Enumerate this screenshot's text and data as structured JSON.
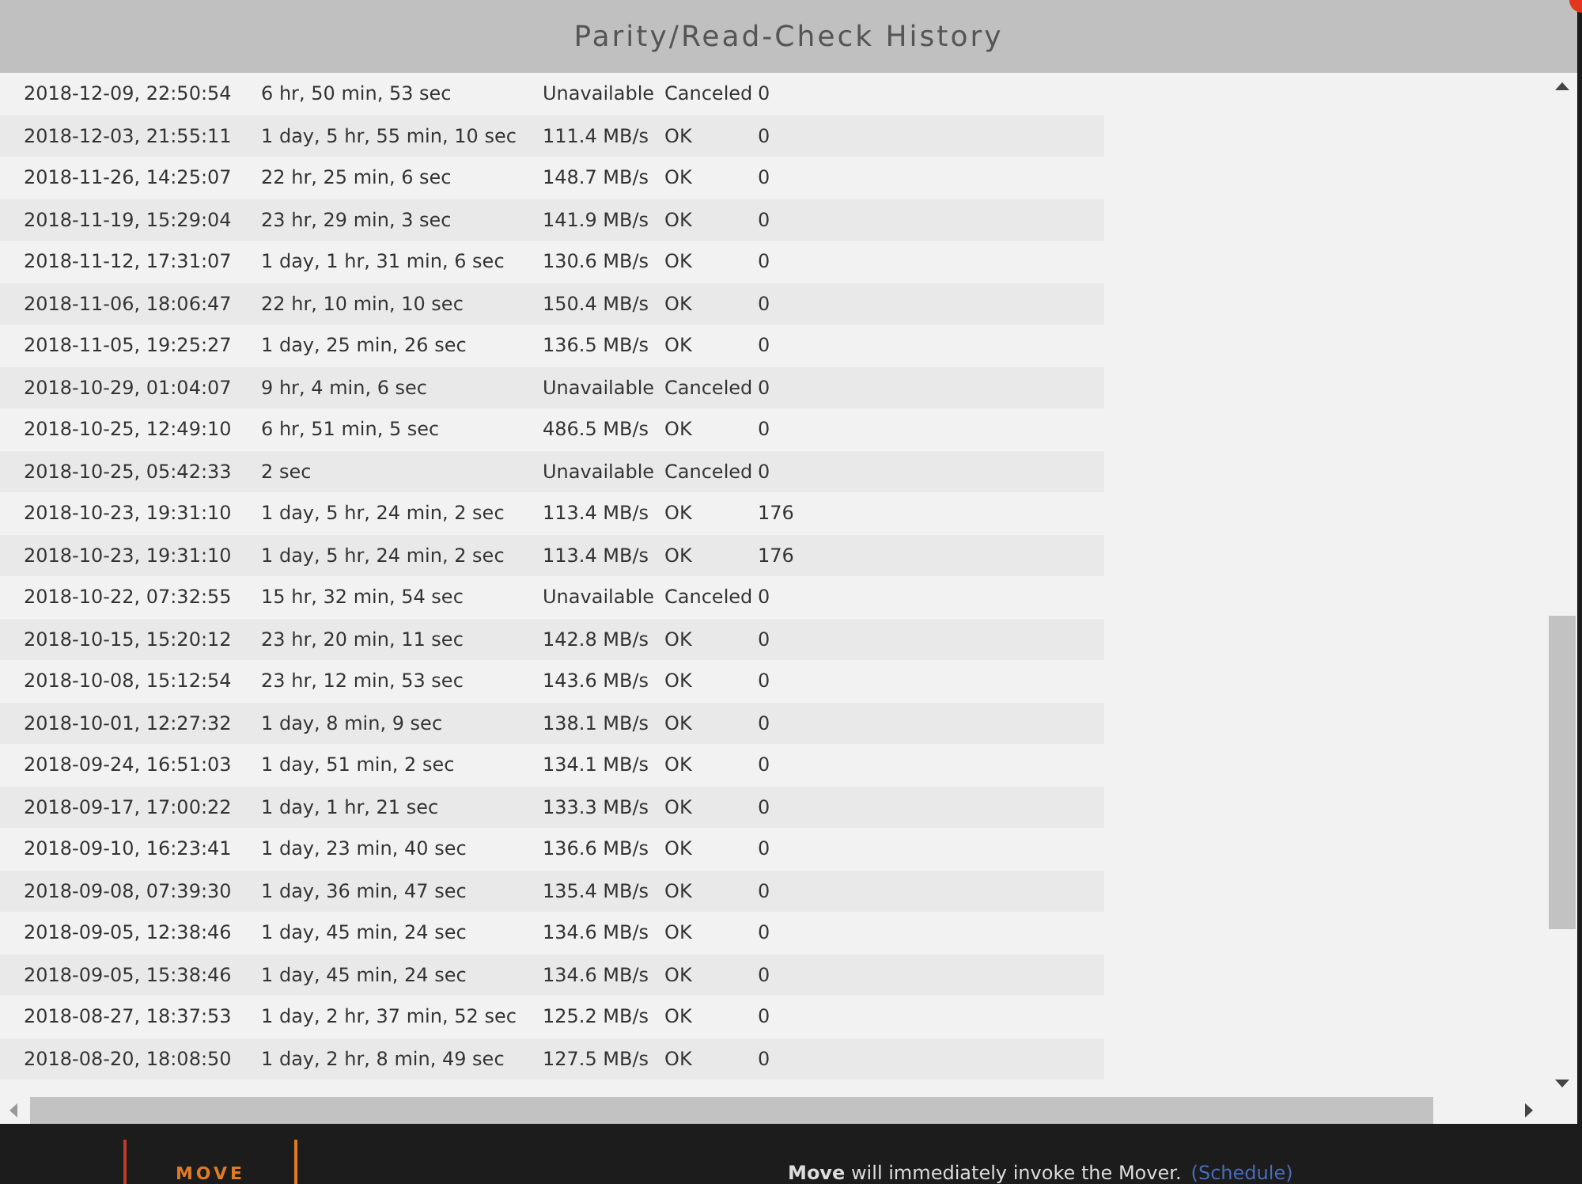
{
  "dialog": {
    "title": "Parity/Read-Check History"
  },
  "rows": [
    {
      "date": "2018-12-09, 22:50:54",
      "duration": "6 hr, 50 min, 53 sec",
      "speed": "Unavailable",
      "status": "Canceled",
      "errors": "0"
    },
    {
      "date": "2018-12-03, 21:55:11",
      "duration": "1 day, 5 hr, 55 min, 10 sec",
      "speed": "111.4 MB/s",
      "status": "OK",
      "errors": "0"
    },
    {
      "date": "2018-11-26, 14:25:07",
      "duration": "22 hr, 25 min, 6 sec",
      "speed": "148.7 MB/s",
      "status": "OK",
      "errors": "0"
    },
    {
      "date": "2018-11-19, 15:29:04",
      "duration": "23 hr, 29 min, 3 sec",
      "speed": "141.9 MB/s",
      "status": "OK",
      "errors": "0"
    },
    {
      "date": "2018-11-12, 17:31:07",
      "duration": "1 day, 1 hr, 31 min, 6 sec",
      "speed": "130.6 MB/s",
      "status": "OK",
      "errors": "0"
    },
    {
      "date": "2018-11-06, 18:06:47",
      "duration": "22 hr, 10 min, 10 sec",
      "speed": "150.4 MB/s",
      "status": "OK",
      "errors": "0"
    },
    {
      "date": "2018-11-05, 19:25:27",
      "duration": "1 day, 25 min, 26 sec",
      "speed": "136.5 MB/s",
      "status": "OK",
      "errors": "0"
    },
    {
      "date": "2018-10-29, 01:04:07",
      "duration": "9 hr, 4 min, 6 sec",
      "speed": "Unavailable",
      "status": "Canceled",
      "errors": "0"
    },
    {
      "date": "2018-10-25, 12:49:10",
      "duration": "6 hr, 51 min, 5 sec",
      "speed": "486.5 MB/s",
      "status": "OK",
      "errors": "0"
    },
    {
      "date": "2018-10-25, 05:42:33",
      "duration": "2 sec",
      "speed": "Unavailable",
      "status": "Canceled",
      "errors": "0"
    },
    {
      "date": "2018-10-23, 19:31:10",
      "duration": "1 day, 5 hr, 24 min, 2 sec",
      "speed": "113.4 MB/s",
      "status": "OK",
      "errors": "176"
    },
    {
      "date": "2018-10-23, 19:31:10",
      "duration": "1 day, 5 hr, 24 min, 2 sec",
      "speed": "113.4 MB/s",
      "status": "OK",
      "errors": "176"
    },
    {
      "date": "2018-10-22, 07:32:55",
      "duration": "15 hr, 32 min, 54 sec",
      "speed": "Unavailable",
      "status": "Canceled",
      "errors": "0"
    },
    {
      "date": "2018-10-15, 15:20:12",
      "duration": "23 hr, 20 min, 11 sec",
      "speed": "142.8 MB/s",
      "status": "OK",
      "errors": "0"
    },
    {
      "date": "2018-10-08, 15:12:54",
      "duration": "23 hr, 12 min, 53 sec",
      "speed": "143.6 MB/s",
      "status": "OK",
      "errors": "0"
    },
    {
      "date": "2018-10-01, 12:27:32",
      "duration": "1 day, 8 min, 9 sec",
      "speed": "138.1 MB/s",
      "status": "OK",
      "errors": "0"
    },
    {
      "date": "2018-09-24, 16:51:03",
      "duration": "1 day, 51 min, 2 sec",
      "speed": "134.1 MB/s",
      "status": "OK",
      "errors": "0"
    },
    {
      "date": "2018-09-17, 17:00:22",
      "duration": "1 day, 1 hr, 21 sec",
      "speed": "133.3 MB/s",
      "status": "OK",
      "errors": "0"
    },
    {
      "date": "2018-09-10, 16:23:41",
      "duration": "1 day, 23 min, 40 sec",
      "speed": "136.6 MB/s",
      "status": "OK",
      "errors": "0"
    },
    {
      "date": "2018-09-08, 07:39:30",
      "duration": "1 day, 36 min, 47 sec",
      "speed": "135.4 MB/s",
      "status": "OK",
      "errors": "0"
    },
    {
      "date": "2018-09-05, 12:38:46",
      "duration": "1 day, 45 min, 24 sec",
      "speed": "134.6 MB/s",
      "status": "OK",
      "errors": "0"
    },
    {
      "date": "2018-09-05, 15:38:46",
      "duration": "1 day, 45 min, 24 sec",
      "speed": "134.6 MB/s",
      "status": "OK",
      "errors": "0"
    },
    {
      "date": "2018-08-27, 18:37:53",
      "duration": "1 day, 2 hr, 37 min, 52 sec",
      "speed": "125.2 MB/s",
      "status": "OK",
      "errors": "0"
    },
    {
      "date": "2018-08-20, 18:08:50",
      "duration": "1 day, 2 hr, 8 min, 49 sec",
      "speed": "127.5 MB/s",
      "status": "OK",
      "errors": "0"
    }
  ],
  "footer": {
    "button": "MOVE",
    "text": "**Move** will immediately invoke the Mover.",
    "link": "(Schedule)"
  }
}
